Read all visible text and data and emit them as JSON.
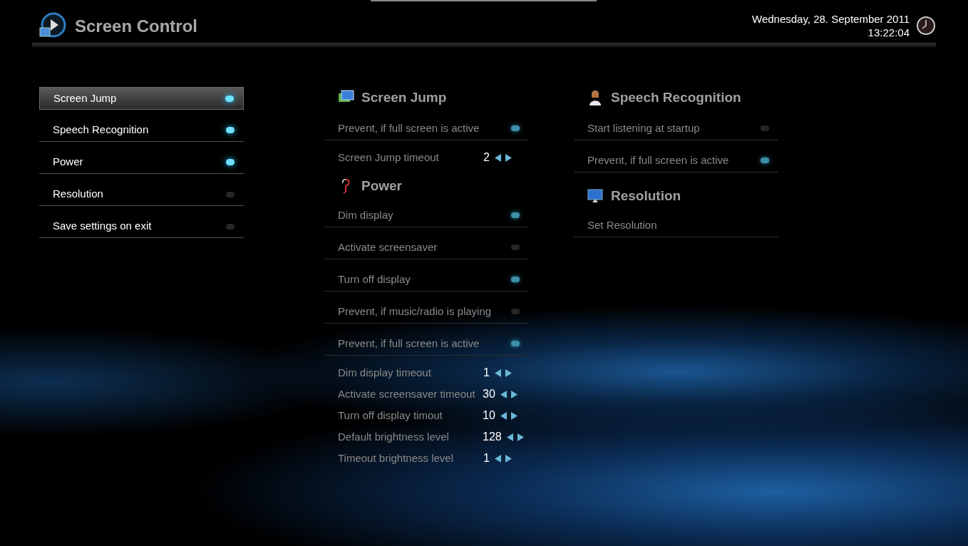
{
  "header": {
    "title": "Screen Control",
    "date": "Wednesday, 28. September 2011",
    "time": "13:22:04"
  },
  "menu": [
    {
      "label": "Screen Jump",
      "selected": true,
      "on": true
    },
    {
      "label": "Speech Recognition",
      "selected": false,
      "on": true
    },
    {
      "label": "Power",
      "selected": false,
      "on": true
    },
    {
      "label": "Resolution",
      "selected": false,
      "on": false
    },
    {
      "label": "Save settings on exit",
      "selected": false,
      "on": false
    }
  ],
  "columns": [
    [
      {
        "title": "Screen Jump",
        "rows": [
          {
            "kind": "toggle",
            "label": "Prevent, if full screen is active",
            "on": true
          },
          {
            "kind": "spinner",
            "label": "Screen Jump timeout",
            "value": "2"
          }
        ]
      },
      {
        "title": "Power",
        "rows": [
          {
            "kind": "toggle",
            "label": "Dim display",
            "on": true
          },
          {
            "kind": "toggle",
            "label": "Activate screensaver",
            "on": false
          },
          {
            "kind": "toggle",
            "label": "Turn off display",
            "on": true
          },
          {
            "kind": "toggle",
            "label": "Prevent, if music/radio is playing",
            "on": false
          },
          {
            "kind": "toggle",
            "label": "Prevent, if full screen is active",
            "on": true
          },
          {
            "kind": "spinner",
            "label": "Dim display timeout",
            "value": "1"
          },
          {
            "kind": "spinner",
            "label": "Activate screensaver timeout",
            "value": "30"
          },
          {
            "kind": "spinner",
            "label": "Turn off display timout",
            "value": "10"
          },
          {
            "kind": "spinner",
            "label": "Default brightness level",
            "value": "128"
          },
          {
            "kind": "spinner",
            "label": "Timeout brightness level",
            "value": "1"
          }
        ]
      }
    ],
    [
      {
        "title": "Speech Recognition",
        "rows": [
          {
            "kind": "toggle",
            "label": "Start listening at startup",
            "on": false
          },
          {
            "kind": "toggle",
            "label": "Prevent, if full screen is active",
            "on": true
          }
        ]
      },
      {
        "title": "Resolution",
        "rows": [
          {
            "kind": "action",
            "label": "Set Resolution"
          }
        ]
      }
    ]
  ]
}
